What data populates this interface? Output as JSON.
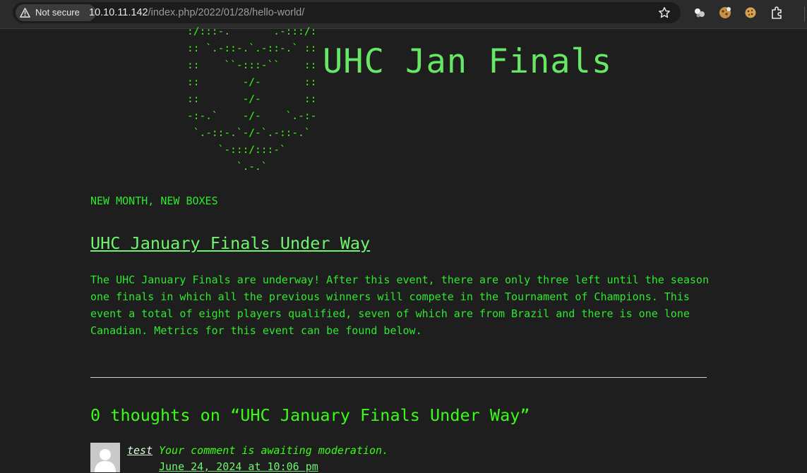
{
  "browser": {
    "security_label": "Not secure",
    "url_host": "10.10.11.142",
    "url_path": "/index.php/2022/01/28/hello-world/",
    "icons": [
      "warning-icon",
      "bookmark-star-icon",
      "extension-puzzle-icon",
      "cookie-extension-icon",
      "cookie-icon",
      "extensions-icon"
    ]
  },
  "site": {
    "ascii_art": ":/:::-.       .-:::/:\n:: `.-::-.`.-::-.` ::\n::    ``-:::-``    ::\n::       -/-       ::\n::       -/-       ::\n-:-.`    -/-    `.-:-\n `.-::-.`-/-`.-::-.`\n     `-:::/:::-`\n        `.-.`",
    "title": "UHC Jan Finals",
    "tagline": "NEW MONTH, NEW BOXES"
  },
  "post": {
    "title": "UHC January Finals Under Way",
    "body": "The UHC January Finals are underway! After this event, there are only three left until the season one finals in which all the previous winners will compete in the Tournament of Champions. This event a total of eight players qualified, seven of which are from Brazil and there is one lone Canadian. Metrics for this event can be found below."
  },
  "comments": {
    "heading": "0 thoughts on “UHC January Finals Under Way”",
    "items": [
      {
        "author": "test",
        "moderation": "Your comment is awaiting moderation.",
        "date": "June 24, 2024 at 10:06 pm"
      }
    ]
  },
  "colors": {
    "background": "#1e1e1e",
    "terminal_green": "#39ff14",
    "light_green": "#66e866"
  }
}
